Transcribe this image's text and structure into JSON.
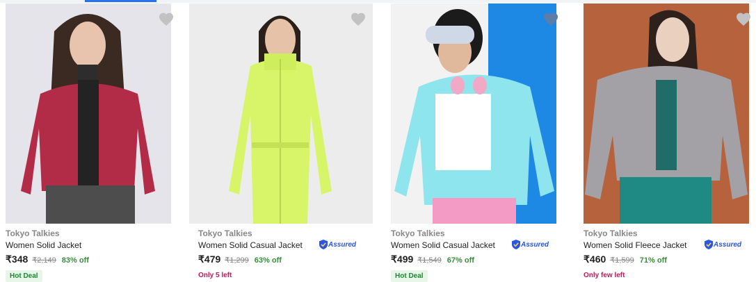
{
  "products": [
    {
      "brand": "Tokyo Talkies",
      "title": "Women Solid Jacket",
      "price": "₹348",
      "mrp": "₹2,149",
      "discount": "83% off",
      "badge": "Hot Deal",
      "assured": false
    },
    {
      "brand": "Tokyo Talkies",
      "title": "Women Solid Casual Jacket",
      "price": "₹479",
      "mrp": "₹1,299",
      "discount": "63% off",
      "stock_note": "Only 5 left",
      "assured": true,
      "assured_label": "Assured"
    },
    {
      "brand": "Tokyo Talkies",
      "title": "Women Solid Casual Jacket",
      "price": "₹499",
      "mrp": "₹1,549",
      "discount": "67% off",
      "badge": "Hot Deal",
      "assured": true,
      "assured_label": "Assured"
    },
    {
      "brand": "Tokyo Talkies",
      "title": "Women Solid Fleece Jacket",
      "price": "₹460",
      "mrp": "₹1,599",
      "discount": "71% off",
      "stock_note": "Only few left",
      "assured": true,
      "assured_label": "Assured"
    }
  ],
  "icons": {
    "wishlist": "heart-icon",
    "assured": "shield-icon"
  },
  "colors": {
    "accent": "#2874f0",
    "discount": "#388e3c",
    "stock_warning": "#c2185b",
    "assured": "#2a55e5"
  }
}
